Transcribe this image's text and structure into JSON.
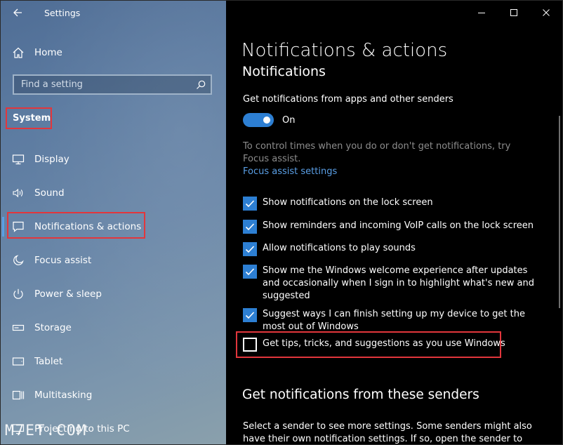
{
  "app": {
    "title": "Settings",
    "watermark": "M7ET.COM"
  },
  "sidebar": {
    "home": "Home",
    "search_placeholder": "Find a setting",
    "category": "System",
    "items": [
      {
        "label": "Display",
        "icon": "display-icon"
      },
      {
        "label": "Sound",
        "icon": "sound-icon"
      },
      {
        "label": "Notifications & actions",
        "icon": "message-icon",
        "selected": true
      },
      {
        "label": "Focus assist",
        "icon": "moon-icon"
      },
      {
        "label": "Power & sleep",
        "icon": "power-icon"
      },
      {
        "label": "Storage",
        "icon": "storage-icon"
      },
      {
        "label": "Tablet",
        "icon": "tablet-icon"
      },
      {
        "label": "Multitasking",
        "icon": "multitasking-icon"
      },
      {
        "label": "Projecting to this PC",
        "icon": "projecting-icon"
      }
    ]
  },
  "main": {
    "title": "Notifications & actions",
    "section": "Notifications",
    "get_notifications_label": "Get notifications from apps and other senders",
    "toggle_state": "On",
    "focus_desc": "To control times when you do or don't get notifications, try Focus assist.",
    "focus_link": "Focus assist settings",
    "checkboxes": [
      {
        "label": "Show notifications on the lock screen",
        "checked": true
      },
      {
        "label": "Show reminders and incoming VoIP calls on the lock screen",
        "checked": true
      },
      {
        "label": "Allow notifications to play sounds",
        "checked": true
      },
      {
        "label": "Show me the Windows welcome experience after updates and occasionally when I sign in to highlight what's new and suggested",
        "checked": true
      },
      {
        "label": "Suggest ways I can finish setting up my device to get the most out of Windows",
        "checked": true
      },
      {
        "label": "Get tips, tricks, and suggestions as you use Windows",
        "checked": false
      }
    ],
    "senders_heading": "Get notifications from these senders",
    "senders_desc": "Select a sender to see more settings. Some senders might also have their own notification settings. If so, open the sender to change them."
  },
  "colors": {
    "accent": "#2d7fd3",
    "link": "#5a9fe6",
    "highlight": "#e2363c"
  }
}
